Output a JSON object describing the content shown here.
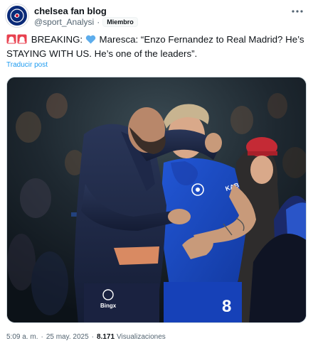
{
  "author": {
    "name": "chelsea fan blog",
    "handle": "@sport_Analysi",
    "separator": "·",
    "badge": "Miembro"
  },
  "tweet": {
    "emoji_alert": "siren-icon",
    "text_breaking": "BREAKING:",
    "emoji_heart": "blue-heart-icon",
    "text_body": " Maresca: “Enzo Fernandez to Real Madrid? He’s STAYING WITH US. He’s one of the leaders”.",
    "translate_label": "Traducir post"
  },
  "media": {
    "shirt_number": "8",
    "sponsor_text": "Bingx",
    "colors": {
      "chelsea_blue": "#1846b8",
      "jacket_navy": "#1b2545"
    }
  },
  "meta": {
    "time": "5:09 a. m.",
    "date": "25 may. 2025",
    "views_count": "8.171",
    "views_label": "Visualizaciones",
    "separator": "·"
  }
}
